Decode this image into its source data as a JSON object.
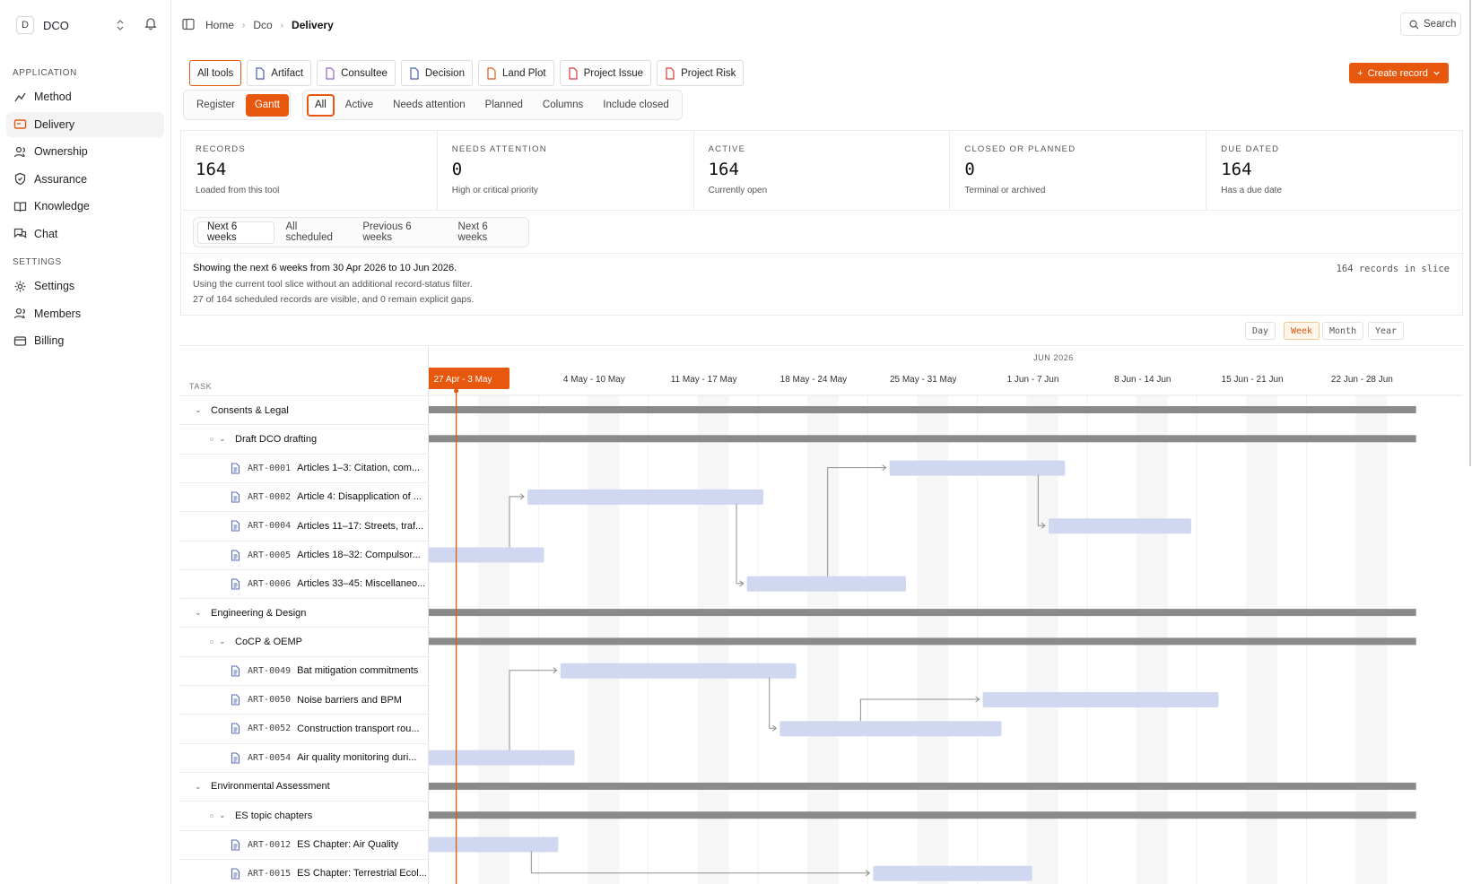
{
  "workspace": {
    "initial": "D",
    "name": "DCO"
  },
  "sidebar": {
    "sections": [
      {
        "label": "APPLICATION",
        "items": [
          {
            "label": "Method",
            "icon": "method-icon",
            "active": false
          },
          {
            "label": "Delivery",
            "icon": "delivery-icon",
            "active": true
          },
          {
            "label": "Ownership",
            "icon": "users-icon",
            "active": false
          },
          {
            "label": "Assurance",
            "icon": "shield-icon",
            "active": false
          },
          {
            "label": "Knowledge",
            "icon": "book-icon",
            "active": false
          },
          {
            "label": "Chat",
            "icon": "chat-icon",
            "active": false
          }
        ]
      },
      {
        "label": "SETTINGS",
        "items": [
          {
            "label": "Settings",
            "icon": "gear-icon",
            "active": false
          },
          {
            "label": "Members",
            "icon": "users-icon",
            "active": false
          },
          {
            "label": "Billing",
            "icon": "card-icon",
            "active": false
          }
        ]
      }
    ]
  },
  "breadcrumb": [
    "Home",
    "Dco",
    "Delivery"
  ],
  "search_label": "Search",
  "tools": [
    "All tools",
    "Artifact",
    "Consultee",
    "Decision",
    "Land Plot",
    "Project Issue",
    "Project Risk"
  ],
  "create_label": "Create record",
  "views": [
    "Register",
    "Gantt"
  ],
  "filters": [
    "All",
    "Active",
    "Needs attention",
    "Planned",
    "Columns",
    "Include closed"
  ],
  "stats": [
    {
      "label": "RECORDS",
      "value": "164",
      "sub": "Loaded from this tool"
    },
    {
      "label": "NEEDS ATTENTION",
      "value": "0",
      "sub": "High or critical priority"
    },
    {
      "label": "ACTIVE",
      "value": "164",
      "sub": "Currently open"
    },
    {
      "label": "CLOSED OR PLANNED",
      "value": "0",
      "sub": "Terminal or archived"
    },
    {
      "label": "DUE DATED",
      "value": "164",
      "sub": "Has a due date"
    }
  ],
  "ranges": [
    "Next 6 weeks",
    "All scheduled",
    "Previous 6 weeks",
    "Next 6 weeks"
  ],
  "info": {
    "line1": "Showing the next 6 weeks from 30 Apr 2026 to 10 Jun 2026.",
    "line2": "Using the current tool slice without an additional record-status filter.",
    "line3": "27 of 164 scheduled records are visible, and 0 remain explicit gaps.",
    "slice": "164 records in slice"
  },
  "zoom": [
    "Day",
    "Week",
    "Month",
    "Year"
  ],
  "zoom_active": "Week",
  "gantt": {
    "task_header": "TASK",
    "month_label": "JUN 2026",
    "weeks": [
      "27 Apr - 3 May",
      "4 May - 10 May",
      "11 May - 17 May",
      "18 May - 24 May",
      "25 May - 31 May",
      "1 Jun - 7 Jun",
      "8 Jun - 14 Jun",
      "15 Jun - 21 Jun",
      "22 Jun - 28 Jun"
    ],
    "current_week": 0,
    "today_week_offset": 0.25,
    "rows": [
      {
        "type": "group",
        "label": "Consents & Legal",
        "bar": [
          0,
          9
        ]
      },
      {
        "type": "sub",
        "label": "Draft DCO drafting",
        "bar": [
          0,
          9
        ]
      },
      {
        "type": "task",
        "code": "ART-0001",
        "label": "Articles 1–3: Citation, com...",
        "bar": [
          4.2,
          5.8
        ]
      },
      {
        "type": "task",
        "code": "ART-0002",
        "label": "Article 4: Disapplication of ...",
        "bar": [
          0.9,
          3.05
        ]
      },
      {
        "type": "task",
        "code": "ART-0004",
        "label": "Articles 11–17: Streets, traf...",
        "bar": [
          5.65,
          6.95
        ]
      },
      {
        "type": "task",
        "code": "ART-0005",
        "label": "Articles 18–32: Compulsor...",
        "bar": [
          0,
          1.05
        ]
      },
      {
        "type": "task",
        "code": "ART-0006",
        "label": "Articles 33–45: Miscellaneo...",
        "bar": [
          2.9,
          4.35
        ]
      },
      {
        "type": "group",
        "label": "Engineering & Design",
        "bar": [
          0,
          9
        ]
      },
      {
        "type": "sub",
        "label": "CoCP & OEMP",
        "bar": [
          0,
          9
        ]
      },
      {
        "type": "task",
        "code": "ART-0049",
        "label": "Bat mitigation commitments",
        "bar": [
          1.2,
          3.35
        ]
      },
      {
        "type": "task",
        "code": "ART-0050",
        "label": "Noise barriers and BPM",
        "bar": [
          5.05,
          7.2
        ]
      },
      {
        "type": "task",
        "code": "ART-0052",
        "label": "Construction transport rou...",
        "bar": [
          3.2,
          5.22
        ]
      },
      {
        "type": "task",
        "code": "ART-0054",
        "label": "Air quality monitoring duri...",
        "bar": [
          0,
          1.33
        ]
      },
      {
        "type": "group",
        "label": "Environmental Assessment",
        "bar": [
          0,
          9
        ]
      },
      {
        "type": "sub",
        "label": "ES topic chapters",
        "bar": [
          0,
          9
        ]
      },
      {
        "type": "task",
        "code": "ART-0012",
        "label": "ES Chapter: Air Quality",
        "bar": [
          0,
          1.18
        ]
      },
      {
        "type": "task",
        "code": "ART-0015",
        "label": "ES Chapter: Terrestrial Ecol...",
        "bar": [
          4.05,
          5.5
        ]
      }
    ],
    "links": [
      [
        5,
        3
      ],
      [
        3,
        6
      ],
      [
        6,
        2
      ],
      [
        2,
        4
      ],
      [
        12,
        9
      ],
      [
        9,
        11
      ],
      [
        11,
        10
      ],
      [
        15,
        16
      ]
    ],
    "colors": {
      "accent": "#e8570e",
      "group_bar": "#8a8a8a",
      "task_bar": "#cfd8f0",
      "link": "#8f8f8f"
    }
  }
}
